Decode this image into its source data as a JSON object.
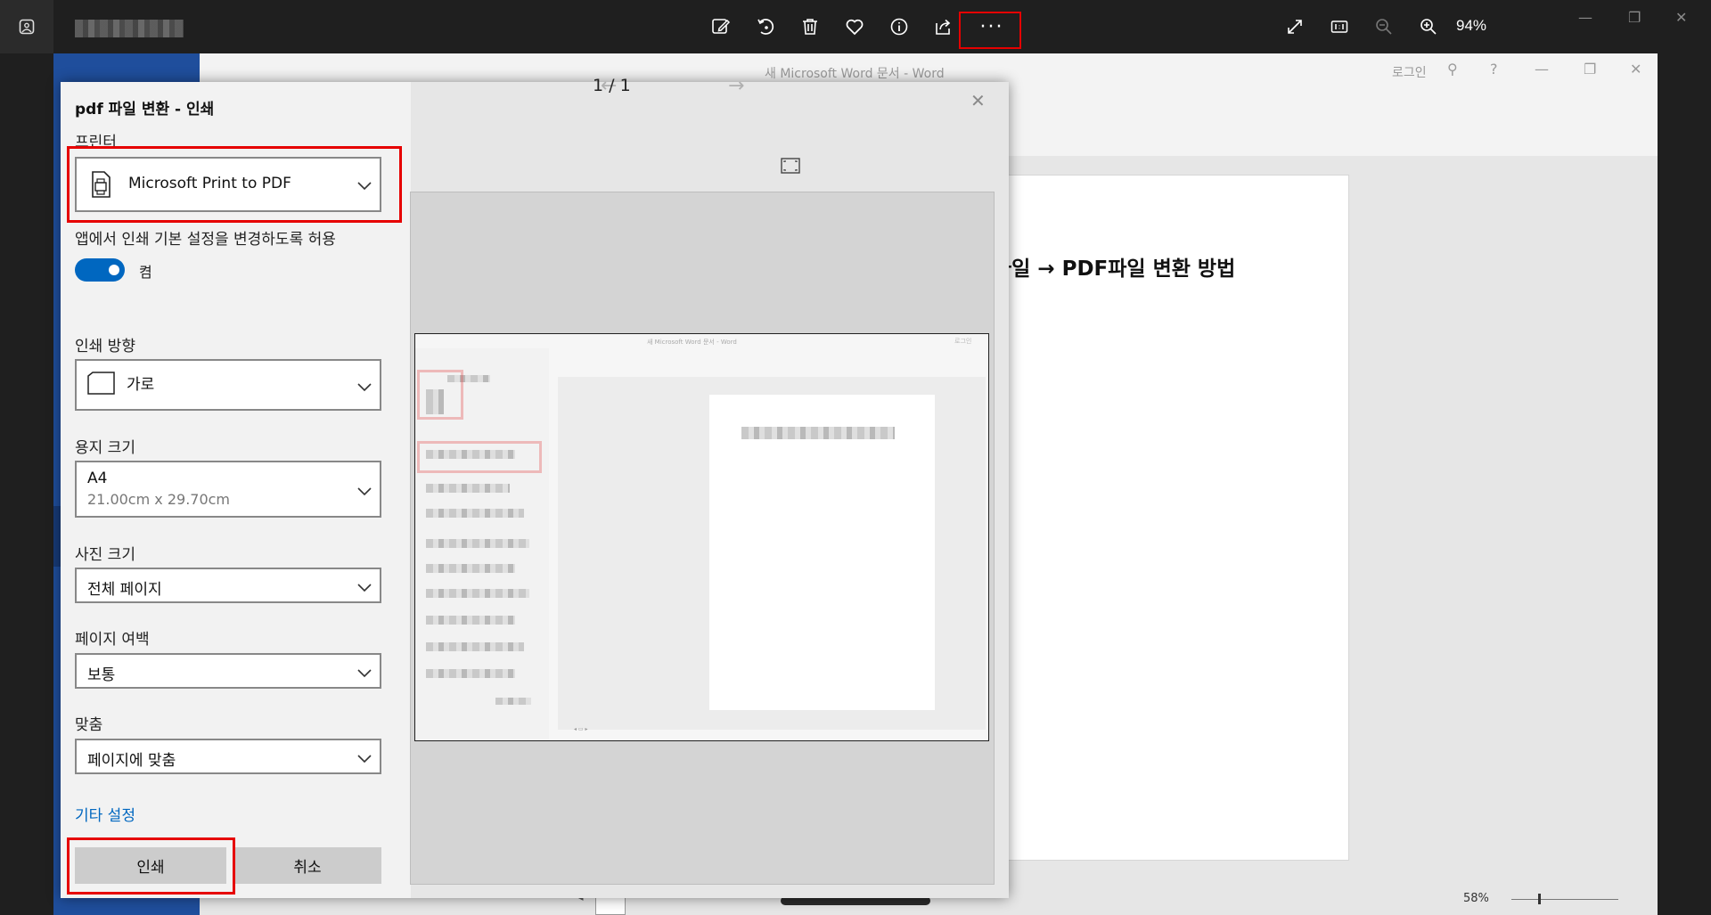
{
  "viewer": {
    "zoom": "94%",
    "toolbar_icons": [
      "edit-icon",
      "rotate-icon",
      "delete-icon",
      "favorite-icon",
      "info-icon",
      "share-icon"
    ],
    "more_label": "···",
    "right_icons": [
      "full-screen-icon",
      "actual-size-icon",
      "zoom-out-icon",
      "zoom-in-icon"
    ]
  },
  "word": {
    "title": "새 Microsoft Word 문서  -  Word",
    "login": "로그인",
    "heading": "파일 → PDF파일 변환 방법",
    "zoom": "58%"
  },
  "dialog": {
    "title": "pdf 파일 변환 - 인쇄",
    "printer_label": "프린터",
    "printer_value": "Microsoft Print to PDF",
    "allow_label": "앱에서 인쇄 기본 설정을 변경하도록 허용",
    "toggle_state": "켬",
    "orientation_label": "인쇄 방향",
    "orientation_value": "가로",
    "paper_label": "용지 크기",
    "paper_value": "A4",
    "paper_dims": "21.00cm x 29.70cm",
    "photo_label": "사진 크기",
    "photo_value": "전체 페이지",
    "margin_label": "페이지 여백",
    "margin_value": "보통",
    "fit_label": "맞춤",
    "fit_value": "페이지에 맞춤",
    "more_settings": "기타 설정",
    "print_button": "인쇄",
    "cancel_button": "취소"
  },
  "preview": {
    "page_indicator": "1  /  1",
    "mini_title": "새 Microsoft Word 문서  -  Word",
    "mini_login": "로그인"
  },
  "colors": {
    "accent": "#0067c0",
    "highlight": "#e60000",
    "word_blue": "#1f4e9c"
  }
}
